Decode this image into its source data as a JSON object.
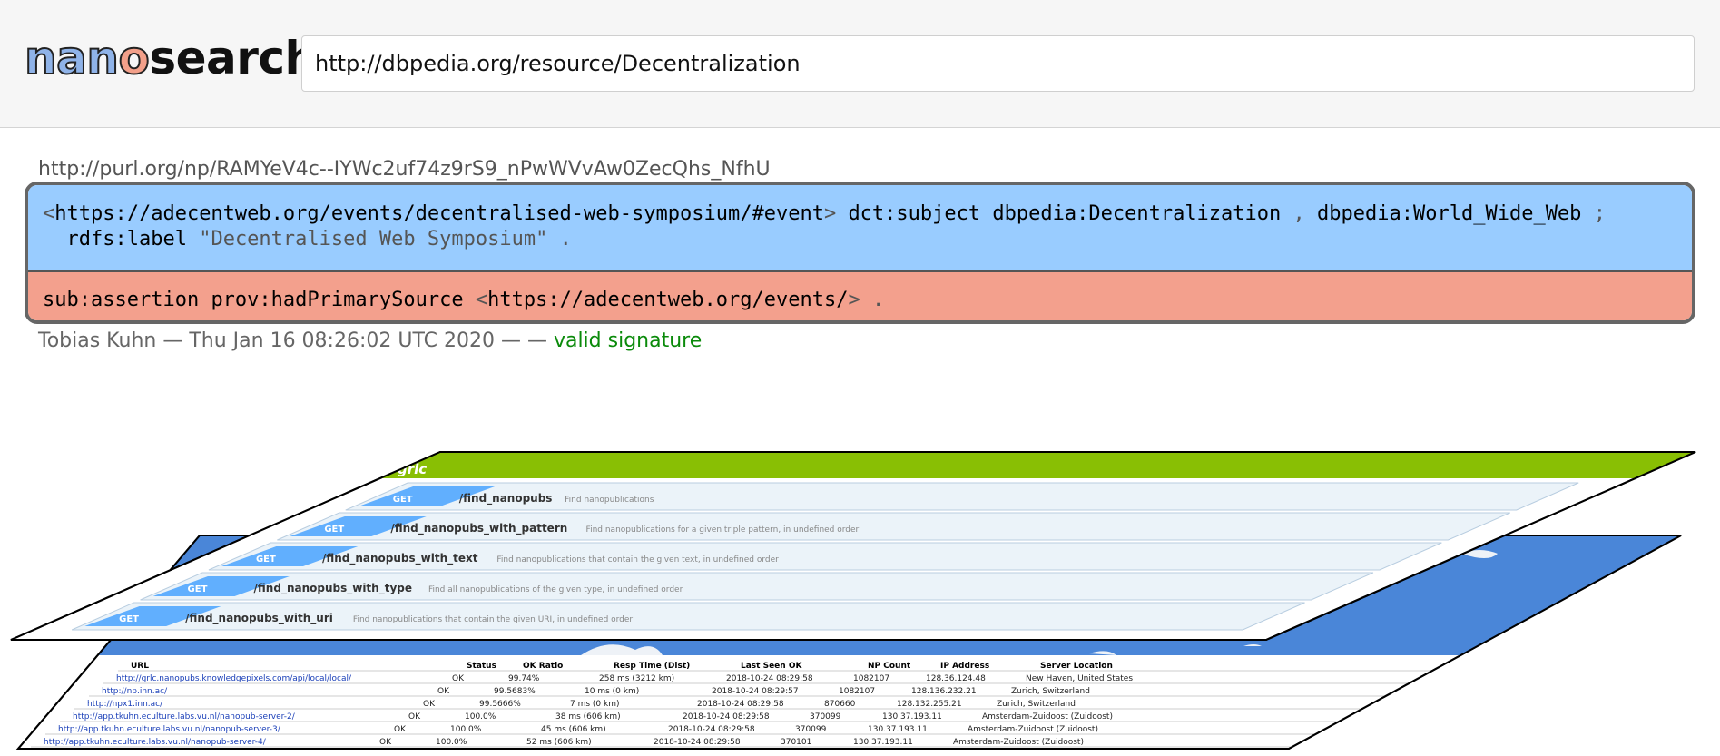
{
  "header": {
    "logo": {
      "part1": "na",
      "part2": "n",
      "part3": "o",
      "part4": "search"
    },
    "search_value": "http://dbpedia.org/resource/Decentralization"
  },
  "nanopub": {
    "uri": "http://purl.org/np/RAMYeV4c--IYWc2uf74z9rS9_nPwWVvAw0ZecQhs_NfhU",
    "assertion": {
      "subject": "https://adecentweb.org/events/decentralised-web-symposium/#event",
      "predicate1": "dct:subject",
      "object1": "dbpedia:Decentralization",
      "object2": "dbpedia:World_Wide_Web",
      "predicate2": "rdfs:label",
      "label": "\"Decentralised Web Symposium\""
    },
    "provenance": {
      "subject": "sub:assertion",
      "predicate": "prov:hadPrimarySource",
      "object": "https://adecentweb.org/events/"
    },
    "footer": {
      "author": "Tobias Kuhn",
      "date": "Thu Jan 16 08:26:02 UTC 2020",
      "signature": "valid signature"
    }
  },
  "illustration": {
    "api_title": "grlc",
    "endpoints": [
      {
        "method": "GET",
        "path": "/find_nanopubs",
        "desc": "Find nanopublications"
      },
      {
        "method": "GET",
        "path": "/find_nanopubs_with_pattern",
        "desc": "Find nanopublications for a given triple pattern, in undefined order"
      },
      {
        "method": "GET",
        "path": "/find_nanopubs_with_text",
        "desc": "Find nanopublications that contain the given text, in undefined order"
      },
      {
        "method": "GET",
        "path": "/find_nanopubs_with_type",
        "desc": "Find all nanopublications of the given type, in undefined order"
      },
      {
        "method": "GET",
        "path": "/find_nanopubs_with_uri",
        "desc": "Find nanopublications that contain the given URI, in undefined order"
      }
    ],
    "server_table": {
      "headers": [
        "URL",
        "Status",
        "OK Ratio",
        "Resp Time (Dist)",
        "Last Seen OK",
        "NP Count",
        "IP Address",
        "Server Location"
      ],
      "rows": [
        [
          "http://grlc.nanopubs.knowledgepixels.com/api/local/local/",
          "OK",
          "99.74%",
          "258 ms (3212 km)",
          "2018-10-24 08:29:58",
          "1082107",
          "128.36.124.48",
          "New Haven, United States"
        ],
        [
          "http://np.inn.ac/",
          "OK",
          "99.5683%",
          "10 ms (0 km)",
          "2018-10-24 08:29:57",
          "1082107",
          "128.136.232.21",
          "Zurich, Switzerland"
        ],
        [
          "http://npx1.inn.ac/",
          "OK",
          "99.5666%",
          "7 ms (0 km)",
          "2018-10-24 08:29:58",
          "870660",
          "128.132.255.21",
          "Zurich, Switzerland"
        ],
        [
          "http://app.tkuhn.eculture.labs.vu.nl/nanopub-server-2/",
          "OK",
          "100.0%",
          "38 ms (606 km)",
          "2018-10-24 08:29:58",
          "370099",
          "130.37.193.11",
          "Amsterdam-Zuidoost (Zuidoost)"
        ],
        [
          "http://app.tkuhn.eculture.labs.vu.nl/nanopub-server-3/",
          "OK",
          "100.0%",
          "45 ms (606 km)",
          "2018-10-24 08:29:58",
          "370099",
          "130.37.193.11",
          "Amsterdam-Zuidoost (Zuidoost)"
        ],
        [
          "http://app.tkuhn.eculture.labs.vu.nl/nanopub-server-4/",
          "OK",
          "100.0%",
          "52 ms (606 km)",
          "2018-10-24 08:29:58",
          "370101",
          "130.37.193.11",
          "Amsterdam-Zuidoost (Zuidoost)"
        ]
      ]
    }
  }
}
